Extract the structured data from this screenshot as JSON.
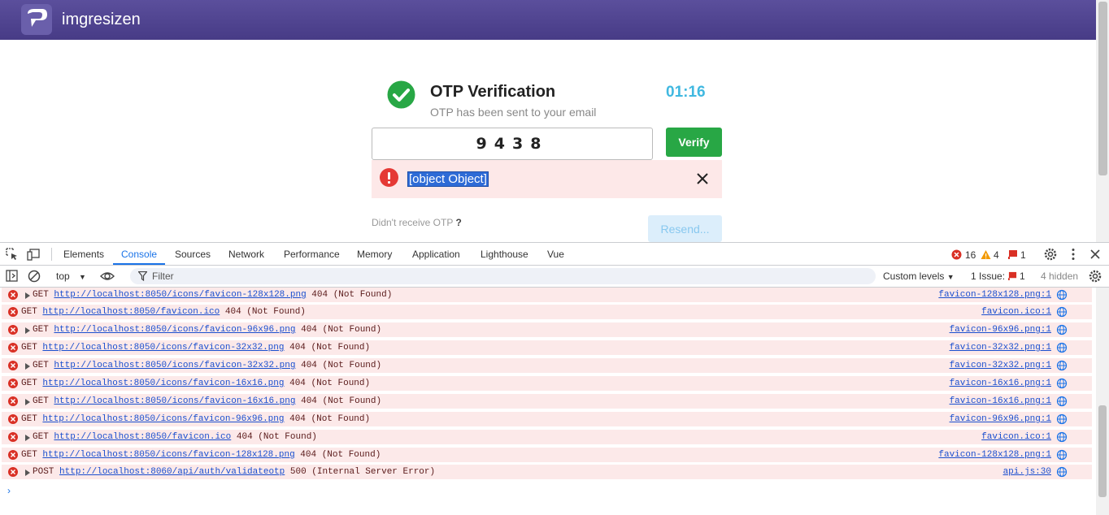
{
  "app": {
    "brand": "imgresizen"
  },
  "otp": {
    "title": "OTP Verification",
    "subtitle": "OTP has been sent to your email",
    "timer": "01:16",
    "code": "9438",
    "verify_label": "Verify",
    "error_text": "[object Object]",
    "didnt_receive": "Didn't receive OTP",
    "question_mark": "?",
    "resend_label": "Resend..."
  },
  "devtools": {
    "tabs": [
      "Elements",
      "Console",
      "Sources",
      "Network",
      "Performance",
      "Memory",
      "Application",
      "Lighthouse",
      "Vue"
    ],
    "active_tab": "Console",
    "error_count": "16",
    "warning_count": "4",
    "issue_badge_count": "1",
    "context": "top",
    "filter_placeholder": "Filter",
    "levels": "Custom levels",
    "issues_label": "1 Issue:",
    "issues_count": "1",
    "hidden": "4 hidden",
    "logs": [
      {
        "expand": true,
        "method": "GET",
        "url": "http://localhost:8050/icons/favicon-128x128.png",
        "status": "404 (Not Found)",
        "source": "favicon-128x128.png:1"
      },
      {
        "expand": false,
        "method": "GET",
        "url": "http://localhost:8050/favicon.ico",
        "status": "404 (Not Found)",
        "source": "favicon.ico:1"
      },
      {
        "expand": true,
        "method": "GET",
        "url": "http://localhost:8050/icons/favicon-96x96.png",
        "status": "404 (Not Found)",
        "source": "favicon-96x96.png:1"
      },
      {
        "expand": false,
        "method": "GET",
        "url": "http://localhost:8050/icons/favicon-32x32.png",
        "status": "404 (Not Found)",
        "source": "favicon-32x32.png:1"
      },
      {
        "expand": true,
        "method": "GET",
        "url": "http://localhost:8050/icons/favicon-32x32.png",
        "status": "404 (Not Found)",
        "source": "favicon-32x32.png:1"
      },
      {
        "expand": false,
        "method": "GET",
        "url": "http://localhost:8050/icons/favicon-16x16.png",
        "status": "404 (Not Found)",
        "source": "favicon-16x16.png:1"
      },
      {
        "expand": true,
        "method": "GET",
        "url": "http://localhost:8050/icons/favicon-16x16.png",
        "status": "404 (Not Found)",
        "source": "favicon-16x16.png:1"
      },
      {
        "expand": false,
        "method": "GET",
        "url": "http://localhost:8050/icons/favicon-96x96.png",
        "status": "404 (Not Found)",
        "source": "favicon-96x96.png:1"
      },
      {
        "expand": true,
        "method": "GET",
        "url": "http://localhost:8050/favicon.ico",
        "status": "404 (Not Found)",
        "source": "favicon.ico:1"
      },
      {
        "expand": false,
        "method": "GET",
        "url": "http://localhost:8050/icons/favicon-128x128.png",
        "status": "404 (Not Found)",
        "source": "favicon-128x128.png:1"
      },
      {
        "expand": true,
        "method": "POST",
        "url": "http://localhost:8060/api/auth/validateotp",
        "status": "500 (Internal Server Error)",
        "source": "api.js:30"
      }
    ],
    "prompt": "›"
  },
  "colors": {
    "navbar": "#473b86",
    "verify": "#28a745",
    "timer": "#40b8e0",
    "error": "#e53935",
    "link": "#1a4fcf"
  }
}
